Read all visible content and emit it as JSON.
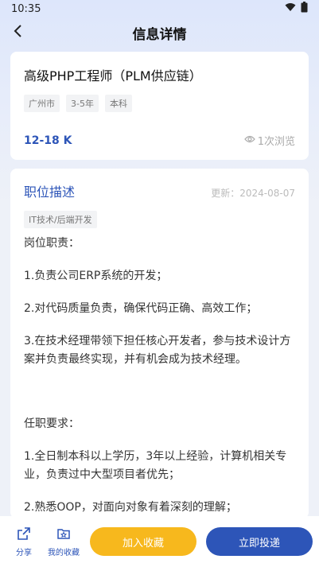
{
  "status": {
    "time": "10:35",
    "wifi_icon": "wifi-icon",
    "battery_icon": "battery-icon"
  },
  "header": {
    "title": "信息详情",
    "back_icon": "chevron-left-icon"
  },
  "job": {
    "title": "高级PHP工程师（PLM供应链）",
    "tags": [
      "广州市",
      "3-5年",
      "本科"
    ],
    "salary": "12-18 K",
    "views": "1次浏览"
  },
  "description": {
    "heading": "职位描述",
    "updated": "更新：2024-08-07",
    "category": "IT技术/后端开发",
    "lines": [
      "岗位职责：",
      "1.负责公司ERP系统的开发；",
      "2.对代码质量负责，确保代码正确、高效工作；",
      "3.在技术经理带领下担任核心开发者，参与技术设计方案并负责最终实现，并有机会成为技术经理。",
      "任职要求：",
      "1.全日制本科以上学历，3年以上经验，计算机相关专业，负责过中大型项目者优先；",
      "2.熟悉OOP，对面向对象有着深刻的理解；"
    ]
  },
  "bottom": {
    "share_label": "分享",
    "favorites_label": "我的收藏",
    "collect_label": "加入收藏",
    "apply_label": "立即投递"
  },
  "colors": {
    "accent": "#2d55b8",
    "collect": "#f7b81d"
  }
}
